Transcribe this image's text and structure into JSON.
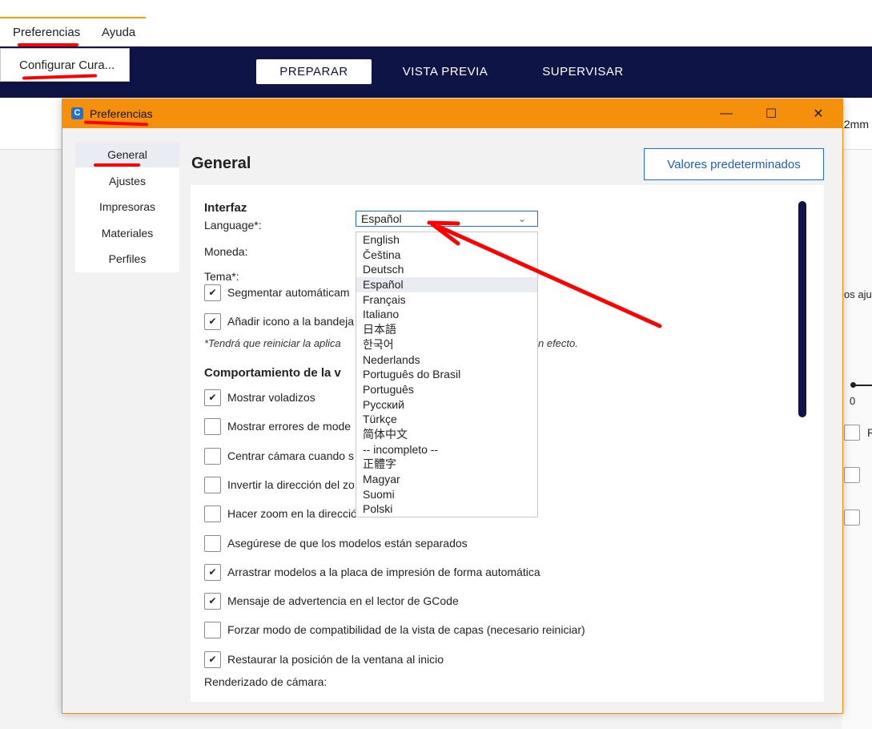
{
  "menubar": {
    "items": [
      "Preferencias",
      "Ayuda"
    ],
    "submenu_item": "Configurar Cura..."
  },
  "stages": [
    "PREPARAR",
    "VISTA PREVIA",
    "SUPERVISAR"
  ],
  "background": {
    "layer_height_fragment": ".2mm",
    "support_fragment": "os aju",
    "slider_zero": "0",
    "r_fragment": "R"
  },
  "dialog": {
    "title": "Preferencias",
    "controls": {
      "minimize": "—",
      "maximize": "☐",
      "close": "✕"
    },
    "sidebar": [
      "General",
      "Ajustes",
      "Impresoras",
      "Materiales",
      "Perfiles"
    ],
    "heading": "General",
    "defaults_button": "Valores predeterminados",
    "interface": {
      "section_title": "Interfaz",
      "language_label": "Language*:",
      "language_value": "Español",
      "currency_label": "Moneda:",
      "theme_label": "Tema*:",
      "auto_slice": "Segmentar automáticam",
      "tray_icon": "Añadir icono a la bandeja",
      "restart_note_start": "*Tendrá que reiniciar la aplica",
      "restart_note_end": "n efecto."
    },
    "viewport": {
      "section_title": "Comportamiento de la v",
      "options": [
        {
          "label": "Mostrar voladizos",
          "checked": true
        },
        {
          "label": "Mostrar errores de mode",
          "checked": false
        },
        {
          "label": "Centrar cámara cuando s",
          "checked": false
        },
        {
          "label": "Invertir la dirección del zo",
          "checked": false
        },
        {
          "label": "Hacer zoom en la dirección del ratón",
          "checked": false
        },
        {
          "label": "Asegúrese de que los modelos están separados",
          "checked": false
        },
        {
          "label": "Arrastrar modelos a la placa de impresión de forma automática",
          "checked": true
        },
        {
          "label": "Mensaje de advertencia en el lector de GCode",
          "checked": true
        },
        {
          "label": "Forzar modo de compatibilidad de la vista de capas (necesario reiniciar)",
          "checked": false
        },
        {
          "label": "Restaurar la posición de la ventana al inicio",
          "checked": true
        }
      ],
      "camera_render_label": "Renderizado de cámara:"
    },
    "language_options": [
      "English",
      "Čeština",
      "Deutsch",
      "Español",
      "Français",
      "Italiano",
      "日本語",
      "한국어",
      "Nederlands",
      "Português do Brasil",
      "Português",
      "Русский",
      "Türkçe",
      "简体中文",
      "-- incompleto --",
      "正體字",
      "Magyar",
      "Suomi",
      "Polski"
    ],
    "selected_language_index": 3
  },
  "colors": {
    "accent": "#f5900d",
    "navbar": "#0f1446",
    "annotation": "#ff0000",
    "link_blue": "#1f6fd6"
  }
}
